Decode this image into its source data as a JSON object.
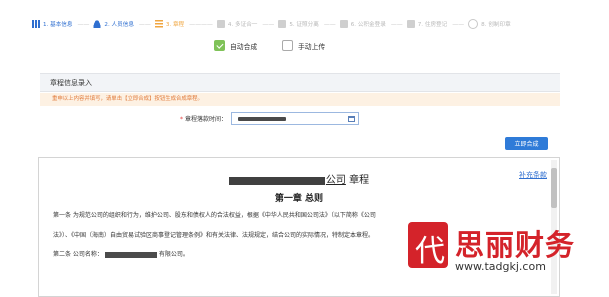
{
  "steps": [
    {
      "label": "1. 基本信息",
      "icon": "bar-chart-icon",
      "state": "done"
    },
    {
      "label": "2. 人员信息",
      "icon": "person-icon",
      "state": "done"
    },
    {
      "label": "3. 章程",
      "icon": "list-icon",
      "state": "active"
    },
    {
      "label": "4. 多证合一",
      "icon": "doc-icon",
      "state": "todo"
    },
    {
      "label": "5. 证照分离",
      "icon": "doc-icon",
      "state": "todo"
    },
    {
      "label": "6. 公积金登录",
      "icon": "doc-icon",
      "state": "todo"
    },
    {
      "label": "7. 住房登记",
      "icon": "doc-icon",
      "state": "todo"
    },
    {
      "label": "8. 创制印章",
      "icon": "gear-icon",
      "state": "todo"
    }
  ],
  "mode": {
    "auto_label": "自动合成",
    "manual_label": "手动上传",
    "auto_checked": true,
    "manual_checked": false
  },
  "section": {
    "title": "章程信息录入",
    "notice": "重申以上内容并填写，请单击【立即合成】按钮生成合成章程。"
  },
  "date_field": {
    "label": "* 章程落款时间：",
    "required_mark": "*",
    "label_text": "章程落款时间："
  },
  "save_button": "立即合成",
  "document": {
    "company_suffix": "公司",
    "title_suffix": "章程",
    "supplement_link": "补充条款",
    "chapter_title": "第一章 总则",
    "para1": "第一条  为规范公司的组织和行为，维护公司、股东和债权人的合法权益，根据《中华人民共和国公司法》（以下简称《公司",
    "para2": "法》）、《中国（海南）自由贸易试验区商事登记管理条例》和有关法律、法规规定，结合公司的实际情况，特制定本章程。",
    "para3_prefix": "第二条  公司名称：",
    "para3_suffix": "有限公司。"
  },
  "watermark": {
    "logo_char": "代",
    "name": "思丽财务",
    "url": "www.tadgkj.com"
  },
  "colors": {
    "accent": "#2f7bd8",
    "active_step": "#f0a640",
    "notice_text": "#e07a3a",
    "notice_bg": "#fdf1e3",
    "check_green": "#7fc258",
    "watermark_red": "#d4232a"
  }
}
